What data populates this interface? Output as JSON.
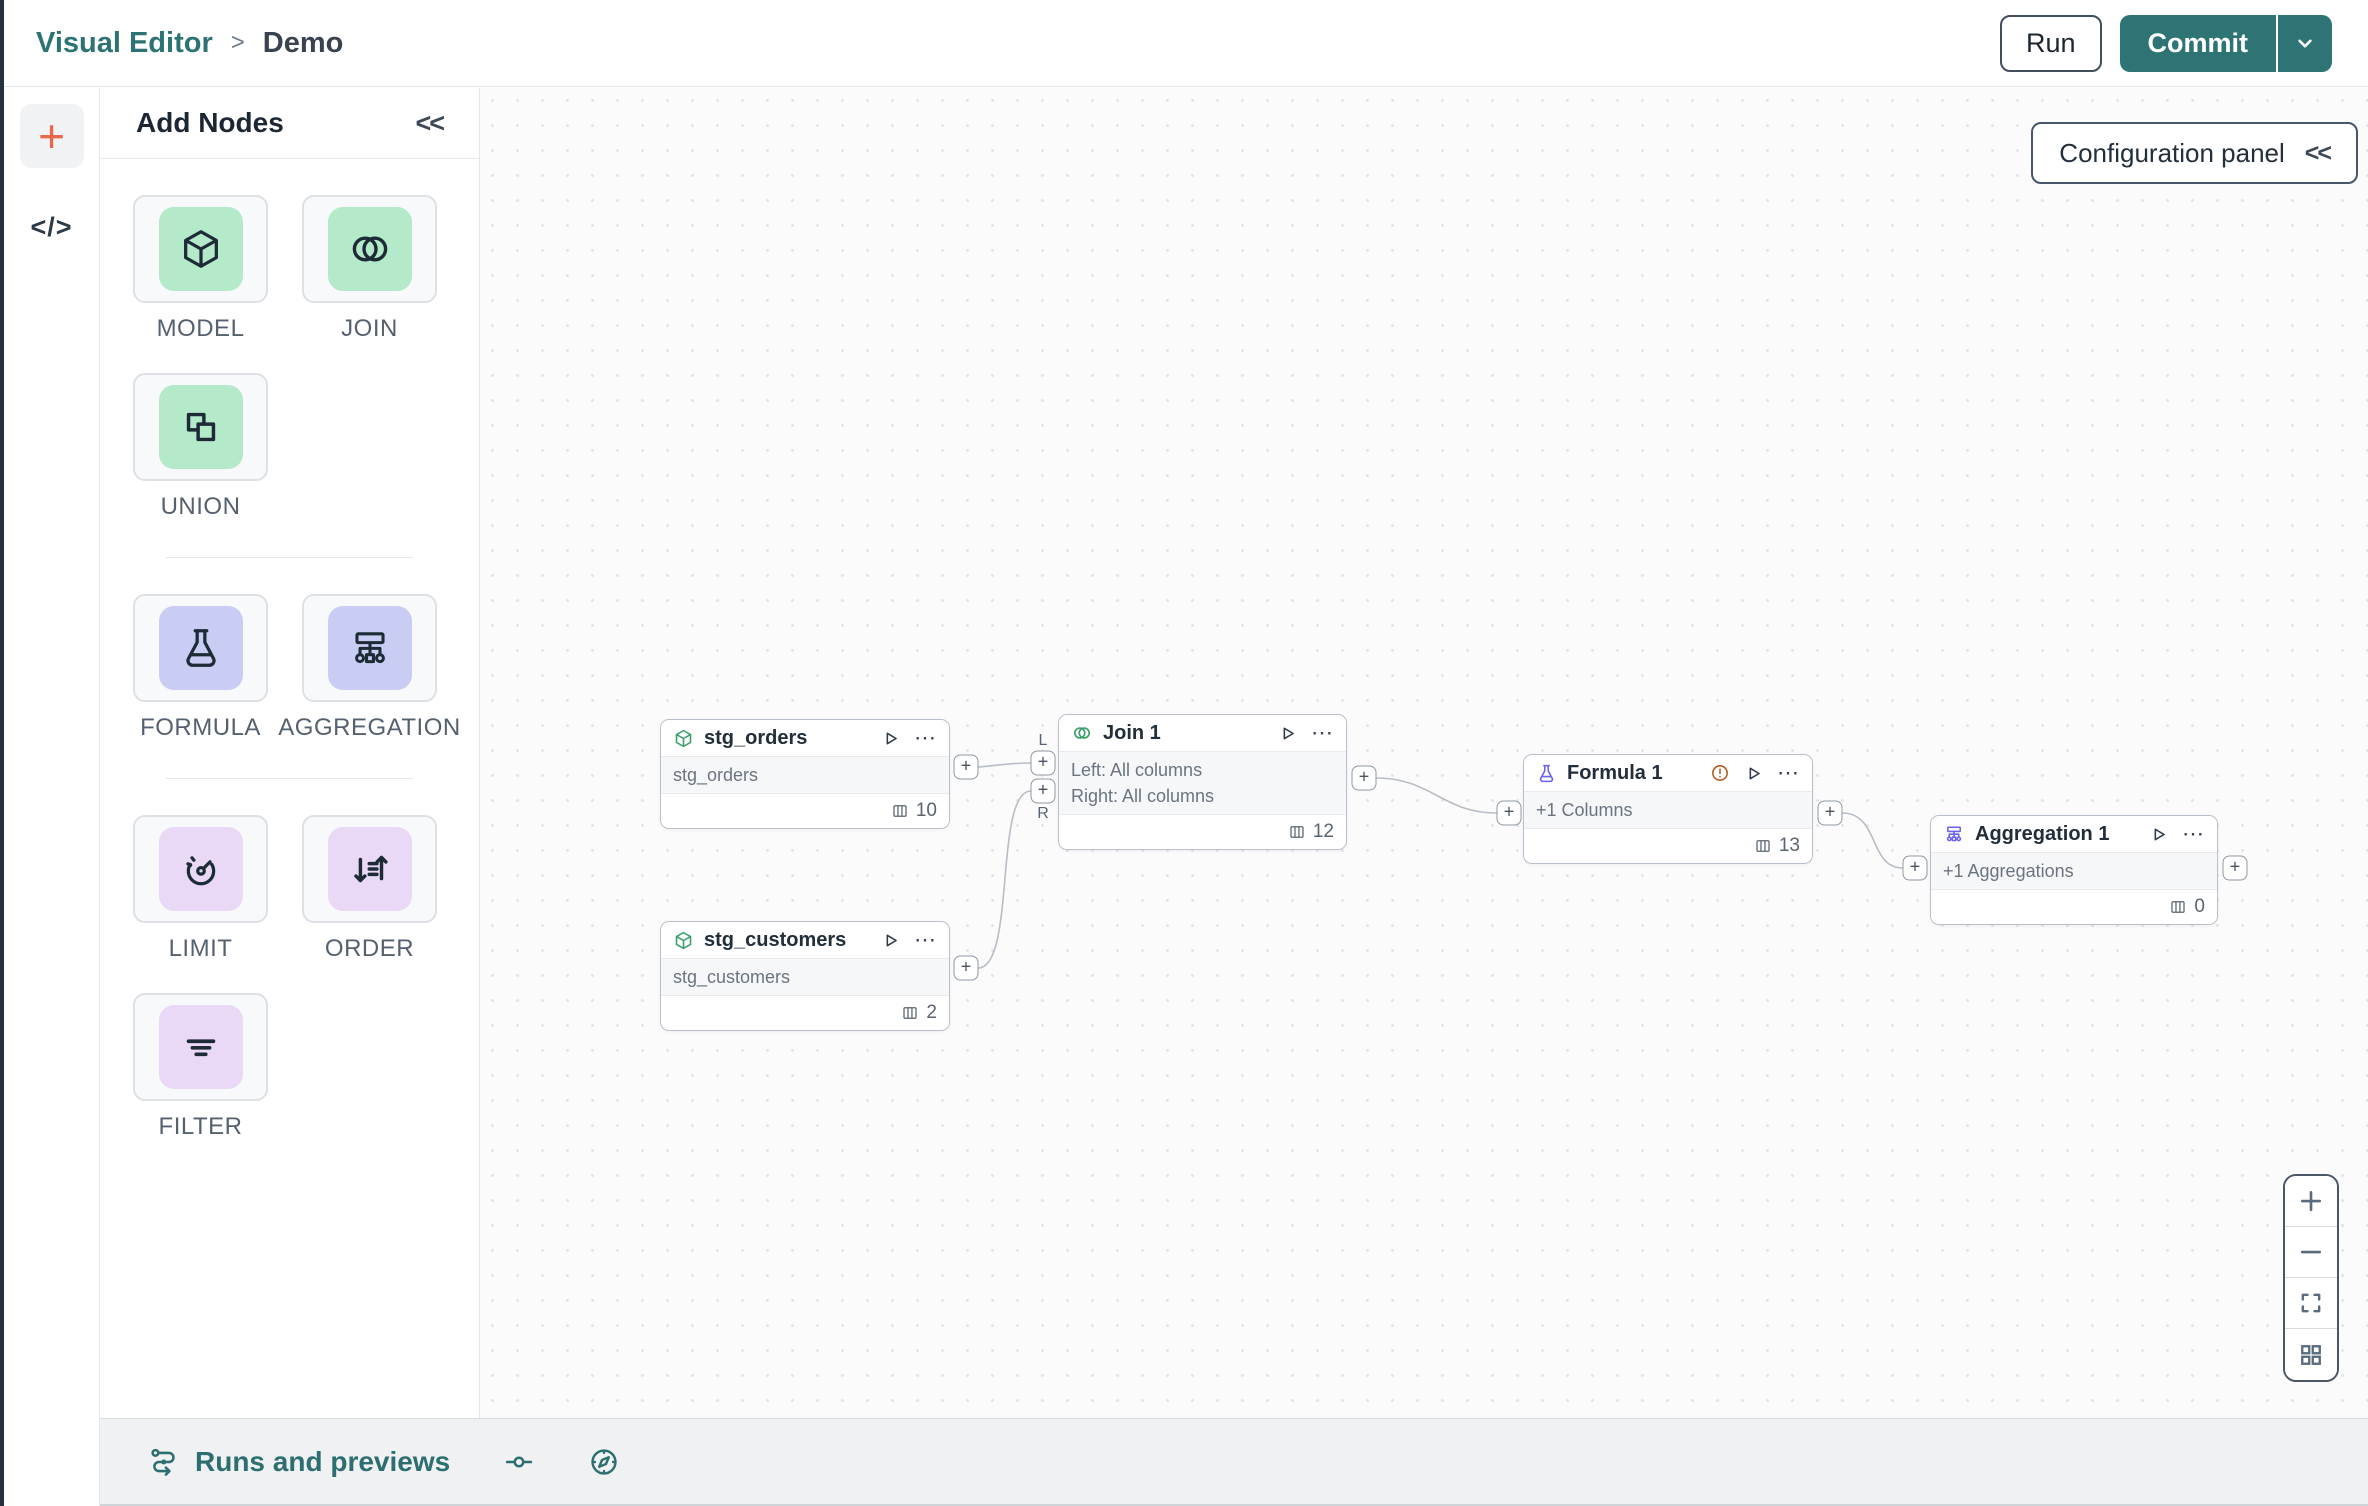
{
  "header": {
    "breadcrumb": {
      "root": "Visual Editor",
      "separator": ">",
      "current": "Demo"
    },
    "run_label": "Run",
    "commit_label": "Commit"
  },
  "rail": {
    "plus_icon": "+",
    "code_icon": "</>"
  },
  "panel": {
    "title": "Add Nodes",
    "collapse_icon": "<<",
    "items": [
      {
        "label": "MODEL",
        "icon": "cube-icon",
        "tile_color": "#b4e9c9"
      },
      {
        "label": "JOIN",
        "icon": "join-circles-icon",
        "tile_color": "#b4e9c9"
      },
      {
        "label": "UNION",
        "icon": "union-squares-icon",
        "tile_color": "#b4e9c9"
      },
      {
        "label": "FORMULA",
        "icon": "flask-icon",
        "tile_color": "#c9cdf4"
      },
      {
        "label": "AGGREGATION",
        "icon": "aggregation-tree-icon",
        "tile_color": "#c9cdf4"
      },
      {
        "label": "LIMIT",
        "icon": "gauge-icon",
        "tile_color": "#ead9f6"
      },
      {
        "label": "ORDER",
        "icon": "sort-arrows-icon",
        "tile_color": "#ead9f6"
      },
      {
        "label": "FILTER",
        "icon": "filter-lines-icon",
        "tile_color": "#ead9f6"
      }
    ]
  },
  "canvas": {
    "config_button": {
      "label": "Configuration panel",
      "collapse_icon": "<<"
    },
    "port_plus": "+",
    "port_labels": {
      "left": "L",
      "right": "R"
    },
    "ellipsis_icon": "⋯",
    "nodes": {
      "stg_orders": {
        "title": "stg_orders",
        "body": "stg_orders",
        "columns": "10"
      },
      "stg_customers": {
        "title": "stg_customers",
        "body": "stg_customers",
        "columns": "2"
      },
      "join1": {
        "title": "Join 1",
        "left": "Left: All columns",
        "right": "Right: All columns",
        "columns": "12"
      },
      "formula1": {
        "title": "Formula 1",
        "body": "+1 Columns",
        "columns": "13"
      },
      "aggregation1": {
        "title": "Aggregation 1",
        "body": "+1 Aggregations",
        "columns": "0"
      }
    }
  },
  "footer": {
    "runs_label": "Runs and previews"
  },
  "colors": {
    "accent_teal": "#2e7475",
    "rail_plus_orange": "#e8684a",
    "tile_green": "#b4e9c9",
    "tile_indigo": "#c9cdf4",
    "tile_purple": "#ead9f6",
    "node_icon_green": "#3aa06a",
    "node_icon_indigo": "#6a63f0",
    "warning_orange": "#b45d20"
  }
}
